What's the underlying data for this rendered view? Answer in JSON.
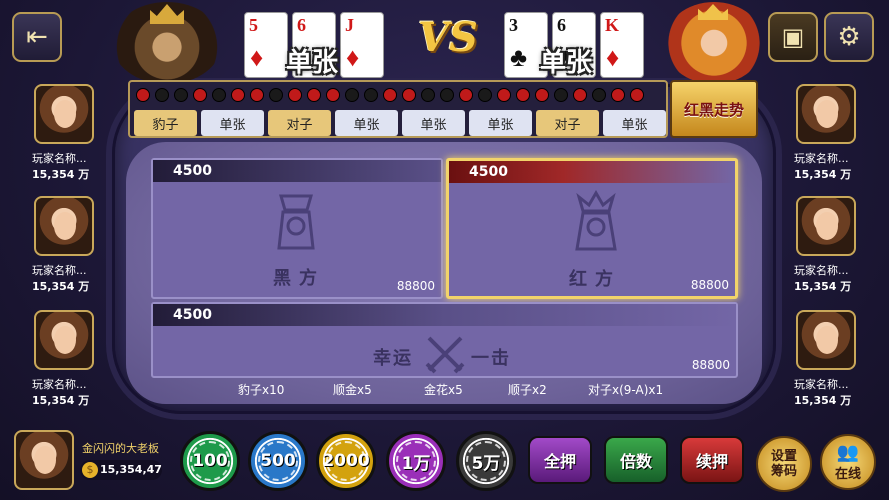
{
  "top": {
    "exit_icon": "exit-icon",
    "settings_icon": "gear-icon",
    "treasure_icon": "treasure-chest-icon",
    "vs": "VS",
    "black_hand": {
      "cards": [
        {
          "rank": "5",
          "suit": "♦",
          "color": "red"
        },
        {
          "rank": "6",
          "suit": "♦",
          "color": "red"
        },
        {
          "rank": "J",
          "suit": "♦",
          "color": "red"
        }
      ],
      "type": "单张"
    },
    "red_hand": {
      "cards": [
        {
          "rank": "3",
          "suit": "♣",
          "color": "black"
        },
        {
          "rank": "6",
          "suit": "♣",
          "color": "black"
        },
        {
          "rank": "K",
          "suit": "♦",
          "color": "red"
        }
      ],
      "type": "单张"
    }
  },
  "trend": {
    "dots": [
      "r",
      "b",
      "b",
      "r",
      "b",
      "r",
      "r",
      "b",
      "r",
      "r",
      "r",
      "b",
      "b",
      "r",
      "r",
      "b",
      "b",
      "r",
      "b",
      "r",
      "r",
      "r",
      "b",
      "r",
      "b",
      "r",
      "r"
    ],
    "tags": [
      {
        "label": "豹子",
        "style": "gold"
      },
      {
        "label": "单张",
        "style": "plain"
      },
      {
        "label": "对子",
        "style": "gold"
      },
      {
        "label": "单张",
        "style": "plain"
      },
      {
        "label": "单张",
        "style": "plain"
      },
      {
        "label": "单张",
        "style": "plain"
      },
      {
        "label": "对子",
        "style": "gold"
      },
      {
        "label": "单张",
        "style": "plain"
      }
    ],
    "button": "红黑走势"
  },
  "players_left": [
    {
      "name": "玩家名称...",
      "money": "15,354 万"
    },
    {
      "name": "玩家名称...",
      "money": "15,354 万"
    },
    {
      "name": "玩家名称...",
      "money": "15,354 万"
    }
  ],
  "players_right": [
    {
      "name": "玩家名称...",
      "money": "15,354 万"
    },
    {
      "name": "玩家名称...",
      "money": "15,354 万"
    },
    {
      "name": "玩家名称...",
      "money": "15,354 万"
    }
  ],
  "areas": {
    "black": {
      "bet": "4500",
      "label": "黑方",
      "total": "88800"
    },
    "red": {
      "bet": "4500",
      "label": "红方",
      "total": "88800"
    },
    "lucky": {
      "bet": "4500",
      "label_left": "幸运",
      "label_right": "一击",
      "total": "88800"
    }
  },
  "odds": [
    "豹子x10",
    "顺金x5",
    "金花x5",
    "顺子x2",
    "对子x(9-A)x1"
  ],
  "self": {
    "name": "金闪闪的大老板",
    "money": "15,354,47"
  },
  "chips": [
    {
      "label": "100",
      "color": "#1e9a4a"
    },
    {
      "label": "500",
      "color": "#2a78c8"
    },
    {
      "label": "2000",
      "color": "#d3a20e"
    },
    {
      "label": "1万",
      "color": "#9a2fb8"
    },
    {
      "label": "5万",
      "color": "#3a3a3a"
    }
  ],
  "actions": {
    "all_in": "全押",
    "double": "倍数",
    "repeat": "续押",
    "chip_setting_1": "设置",
    "chip_setting_2": "筹码",
    "online": "在线"
  }
}
